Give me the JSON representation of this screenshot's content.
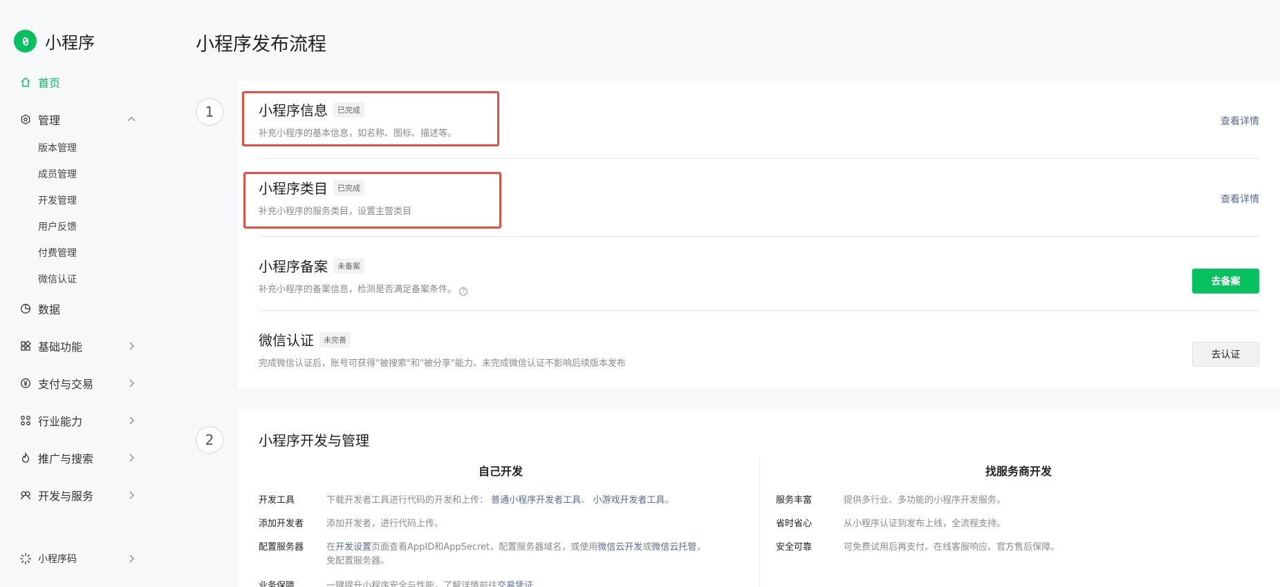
{
  "brand": {
    "name": "小程序"
  },
  "sidebar": {
    "home": "首页",
    "manage": "管理",
    "manage_items": [
      "版本管理",
      "成员管理",
      "开发管理",
      "用户反馈",
      "付费管理",
      "微信认证"
    ],
    "data": "数据",
    "basic": "基础功能",
    "payment": "支付与交易",
    "industry": "行业能力",
    "promotion": "推广与搜索",
    "devservice": "开发与服务",
    "qrcode": "小程序码"
  },
  "page": {
    "title": "小程序发布流程"
  },
  "steps": {
    "one": "1",
    "two": "2"
  },
  "card1": {
    "rows": [
      {
        "title": "小程序信息",
        "badge": "已完成",
        "desc": "补充小程序的基本信息，如名称、图标、描述等。",
        "action": "查看详情"
      },
      {
        "title": "小程序类目",
        "badge": "已完成",
        "desc": "补充小程序的服务类目，设置主营类目",
        "action": "查看详情"
      },
      {
        "title": "小程序备案",
        "badge": "未备案",
        "desc": "补充小程序的备案信息，检测是否满足备案条件。",
        "action": "去备案"
      },
      {
        "title": "微信认证",
        "badge": "未完善",
        "desc": "完成微信认证后，账号可获得\"被搜索\"和\"被分享\"能力。未完成微信认证不影响后续版本发布",
        "action": "去认证"
      }
    ],
    "help_glyph": "?"
  },
  "card2": {
    "title": "小程序开发与管理",
    "self": {
      "heading": "自己开发",
      "items": [
        {
          "k": "开发工具",
          "v1": "下载开发者工具进行代码的开发和上传：",
          "link1": "普通小程序开发者工具",
          "sep": "、",
          "link2": "小游戏开发者工具",
          "v2": "。"
        },
        {
          "k": "添加开发者",
          "v1": "添加开发者，进行代码上传。"
        },
        {
          "k": "配置服务器",
          "v1": "在",
          "link1": "开发设置",
          "v2": "页面查看AppID和AppSecret，配置服务器域名，或使用",
          "link2": "微信云开发",
          "v3": "或",
          "link3": "微信云托管",
          "v4": "，",
          "line2": "免配置服务器。"
        },
        {
          "k": "业务保障",
          "v1": "一键提升小程序安全与性能，了解详情前往",
          "link1": "交易凭证"
        }
      ]
    },
    "vendor": {
      "heading": "找服务商开发",
      "items": [
        {
          "k": "服务丰富",
          "v": "提供多行业、多功能的小程序开发服务。"
        },
        {
          "k": "省时省心",
          "v": "从小程序认证到发布上线，全流程支持。"
        },
        {
          "k": "安全可靠",
          "v": "可免费试用后再支付、在线客服响应、官方售后保障。"
        }
      ]
    }
  },
  "colors": {
    "accent": "#07c160",
    "link": "#576b95",
    "highlight": "#e54d42"
  }
}
